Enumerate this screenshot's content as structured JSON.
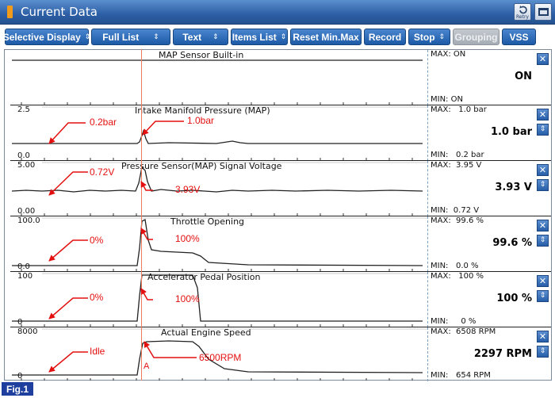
{
  "window": {
    "title": "Current Data",
    "retry_label": "Retry",
    "title_icon": "orange-bar-icon",
    "retry_icon": "retry-icon",
    "window_icon": "window-restore-icon"
  },
  "toolbar": {
    "buttons": [
      {
        "label": "Selective Display",
        "caret": "⇕",
        "enabled": true
      },
      {
        "label": "Full List",
        "caret": "⇕",
        "enabled": true
      },
      {
        "label": "Text",
        "caret": "⇕",
        "enabled": true
      },
      {
        "label": "Items List",
        "caret": "⇕",
        "enabled": true
      },
      {
        "label": "Reset Min.Max",
        "caret": "",
        "enabled": true
      },
      {
        "label": "Record",
        "caret": "",
        "enabled": true
      },
      {
        "label": "Stop",
        "caret": "⇕",
        "enabled": true
      },
      {
        "label": "Grouping",
        "caret": "",
        "enabled": false
      },
      {
        "label": "VSS",
        "caret": "",
        "enabled": true
      }
    ]
  },
  "graphs": [
    {
      "title": "MAP Sensor Built-in",
      "scale_top": "",
      "scale_bottom": "",
      "max": "MAX: ON",
      "min": "MIN: ON",
      "value": "ON",
      "has_toggle": false
    },
    {
      "title": "Intake Manifold Pressure (MAP)",
      "scale_top": "2.5",
      "scale_bottom": "0.0",
      "max": "MAX:   1.0 bar",
      "min": "MIN:   0.2 bar",
      "value": "1.0 bar",
      "has_toggle": true
    },
    {
      "title": "Pressure Sensor(MAP) Signal Voltage",
      "scale_top": "5.00",
      "scale_bottom": "0.00",
      "max": "MAX:  3.95 V",
      "min": "MIN:  0.72 V",
      "value": "3.93 V",
      "has_toggle": true
    },
    {
      "title": "Throttle Opening",
      "scale_top": "100.0",
      "scale_bottom": "0.0",
      "max": "MAX:  99.6 %",
      "min": "MIN:   0.0 %",
      "value": "99.6 %",
      "has_toggle": true
    },
    {
      "title": "Accelerator Pedal Position",
      "scale_top": "100",
      "scale_bottom": "0",
      "max": "MAX:   100 %",
      "min": "MIN:     0 %",
      "value": "100 %",
      "has_toggle": true
    },
    {
      "title": "Actual Engine Speed",
      "scale_top": "8000",
      "scale_bottom": "0",
      "max": "MAX:  6508 RPM",
      "min": "MIN:   654 RPM",
      "value": "2297 RPM",
      "has_toggle": true
    }
  ],
  "annotations": {
    "map_idle": "0.2bar",
    "map_peak": "1.0bar",
    "volt_idle": "0.72V",
    "volt_peak": "3.93V",
    "tps_idle": "0%",
    "tps_peak": "100%",
    "app_idle": "0%",
    "app_peak": "100%",
    "rpm_idle": "Idle",
    "rpm_peak": "6500RPM",
    "cursor": "A"
  },
  "figure_label": "Fig.1",
  "colors": {
    "title_bar": "#2d5fa6",
    "button": "#1d5aa6",
    "annotation": "#e41010",
    "cursor": "#f07a5a"
  }
}
